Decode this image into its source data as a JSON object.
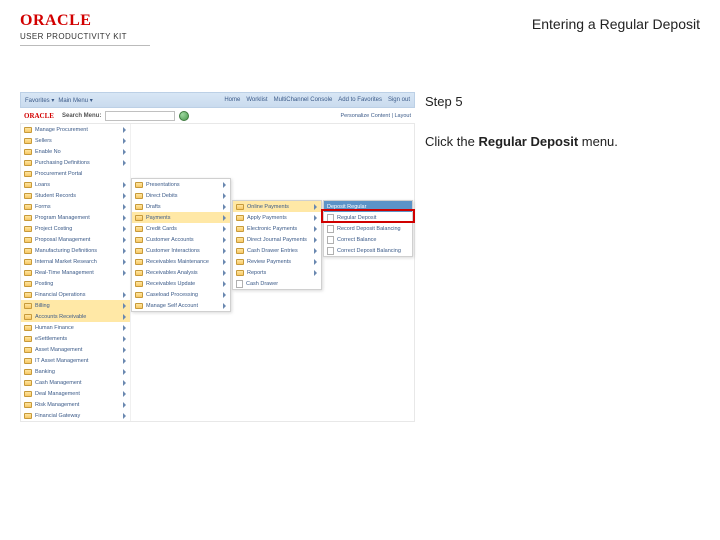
{
  "header": {
    "brand_logo": "ORACLE",
    "brand_sub": "USER PRODUCTIVITY KIT",
    "doc_title": "Entering a Regular Deposit"
  },
  "instructions": {
    "step_label": "Step 5",
    "line_prefix": "Click the ",
    "line_bold": "Regular Deposit",
    "line_suffix": " menu."
  },
  "app": {
    "topbar_left": [
      "Favorites ▾",
      "Main Menu ▾"
    ],
    "topbar_right": [
      "Home",
      "Worklist",
      "MultiChannel Console",
      "Add to Favorites",
      "Sign out"
    ],
    "mini_logo": "ORACLE",
    "search_label": "Search Menu:",
    "personalize": "Personalize Content | Layout",
    "nav_items": [
      {
        "label": "Manage Procurement",
        "caret": true
      },
      {
        "label": "Sellers",
        "caret": true
      },
      {
        "label": "Enable No",
        "caret": true
      },
      {
        "label": "Purchasing Definitions",
        "caret": true
      },
      {
        "label": "Procurement Portal",
        "caret": false
      },
      {
        "label": "Loans",
        "caret": true
      },
      {
        "label": "Student Records",
        "caret": true
      },
      {
        "label": "Forms",
        "caret": true
      },
      {
        "label": "Program Management",
        "caret": true
      },
      {
        "label": "Project Costing",
        "caret": true
      },
      {
        "label": "Proposal Management",
        "caret": true
      },
      {
        "label": "Manufacturing Definitions",
        "caret": true
      },
      {
        "label": "Internal Market Research",
        "caret": true
      },
      {
        "label": "Real-Time Management",
        "caret": true
      },
      {
        "label": "Posting",
        "caret": false
      },
      {
        "label": "Financial Operations",
        "caret": true
      },
      {
        "label": "Billing",
        "caret": true,
        "hl": true
      },
      {
        "label": "Accounts Receivable",
        "caret": true,
        "hl": true
      },
      {
        "label": "Human Finance",
        "caret": true
      },
      {
        "label": "eSettlements",
        "caret": true
      },
      {
        "label": "Asset Management",
        "caret": true
      },
      {
        "label": "IT Asset Management",
        "caret": true
      },
      {
        "label": "Banking",
        "caret": true
      },
      {
        "label": "Cash Management",
        "caret": true
      },
      {
        "label": "Deal Management",
        "caret": true
      },
      {
        "label": "Risk Management",
        "caret": true
      },
      {
        "label": "Financial Gateway",
        "caret": true
      }
    ],
    "fly1": [
      {
        "label": "Presentations",
        "caret": true
      },
      {
        "label": "Direct Debits",
        "caret": true
      },
      {
        "label": "Drafts",
        "caret": true
      },
      {
        "label": "Payments",
        "caret": true,
        "hl": true
      },
      {
        "label": "Credit Cards",
        "caret": true
      },
      {
        "label": "Customer Accounts",
        "caret": true
      },
      {
        "label": "Customer Interactions",
        "caret": true
      },
      {
        "label": "Receivables Maintenance",
        "caret": true
      },
      {
        "label": "Receivables Analysis",
        "caret": true
      },
      {
        "label": "Receivables Update",
        "caret": true
      },
      {
        "label": "Caseload Processing",
        "caret": true
      },
      {
        "label": "Manage Self Account",
        "caret": true
      }
    ],
    "fly2": [
      {
        "label": "Online Payments",
        "caret": true,
        "hl": true
      },
      {
        "label": "Apply Payments",
        "caret": true
      },
      {
        "label": "Electronic Payments",
        "caret": true
      },
      {
        "label": "Direct Journal Payments",
        "caret": true
      },
      {
        "label": "Cash Drawer Entries",
        "caret": true
      },
      {
        "label": "Review Payments",
        "caret": true
      },
      {
        "label": "Reports",
        "caret": true
      },
      {
        "label": "Cash Drawer",
        "caret": false
      }
    ],
    "fly3_head": "Deposit Regular",
    "fly3": [
      {
        "label": "Regular Deposit"
      },
      {
        "label": "Record Deposit Balancing"
      },
      {
        "label": "Correct Balance"
      },
      {
        "label": "Correct Deposit Balancing"
      }
    ]
  }
}
